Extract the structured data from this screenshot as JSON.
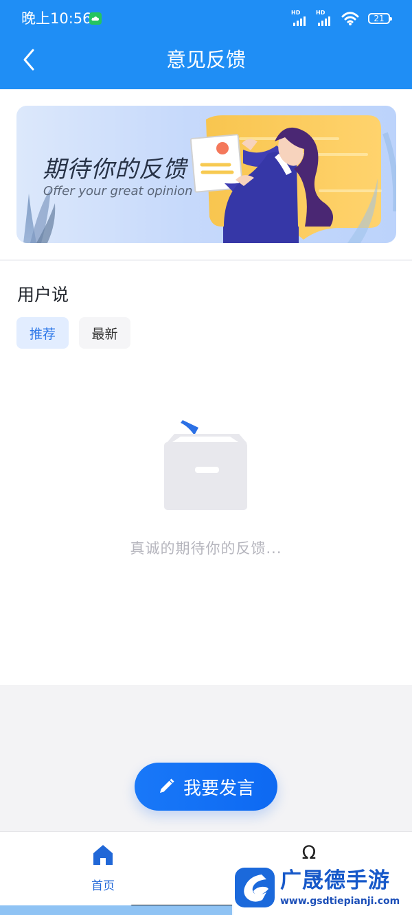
{
  "status_bar": {
    "time": "晚上10:56",
    "network_label_1": "HD",
    "network_label_2": "HD",
    "battery": "21"
  },
  "header": {
    "title": "意见反馈",
    "back_icon": "chevron-left-icon"
  },
  "banner": {
    "title": "期待你的反馈",
    "subtitle": "Offer your great opinion"
  },
  "feedback_section": {
    "title": "用户说",
    "tabs": [
      {
        "label": "推荐",
        "selected": true
      },
      {
        "label": "最新",
        "selected": false
      }
    ],
    "empty_message": "真诚的期待你的反馈..."
  },
  "actions": {
    "post_label": "我要发言",
    "post_icon": "pencil-icon"
  },
  "bottom_nav": {
    "home_label": "首页",
    "second_icon": "Ω"
  },
  "watermark": {
    "title": "广晟德手游",
    "url": "www.gsdtiepianji.com"
  },
  "colors": {
    "primary": "#1f8ef5",
    "accent": "#1978f8",
    "text_muted": "#b5b5bd"
  }
}
